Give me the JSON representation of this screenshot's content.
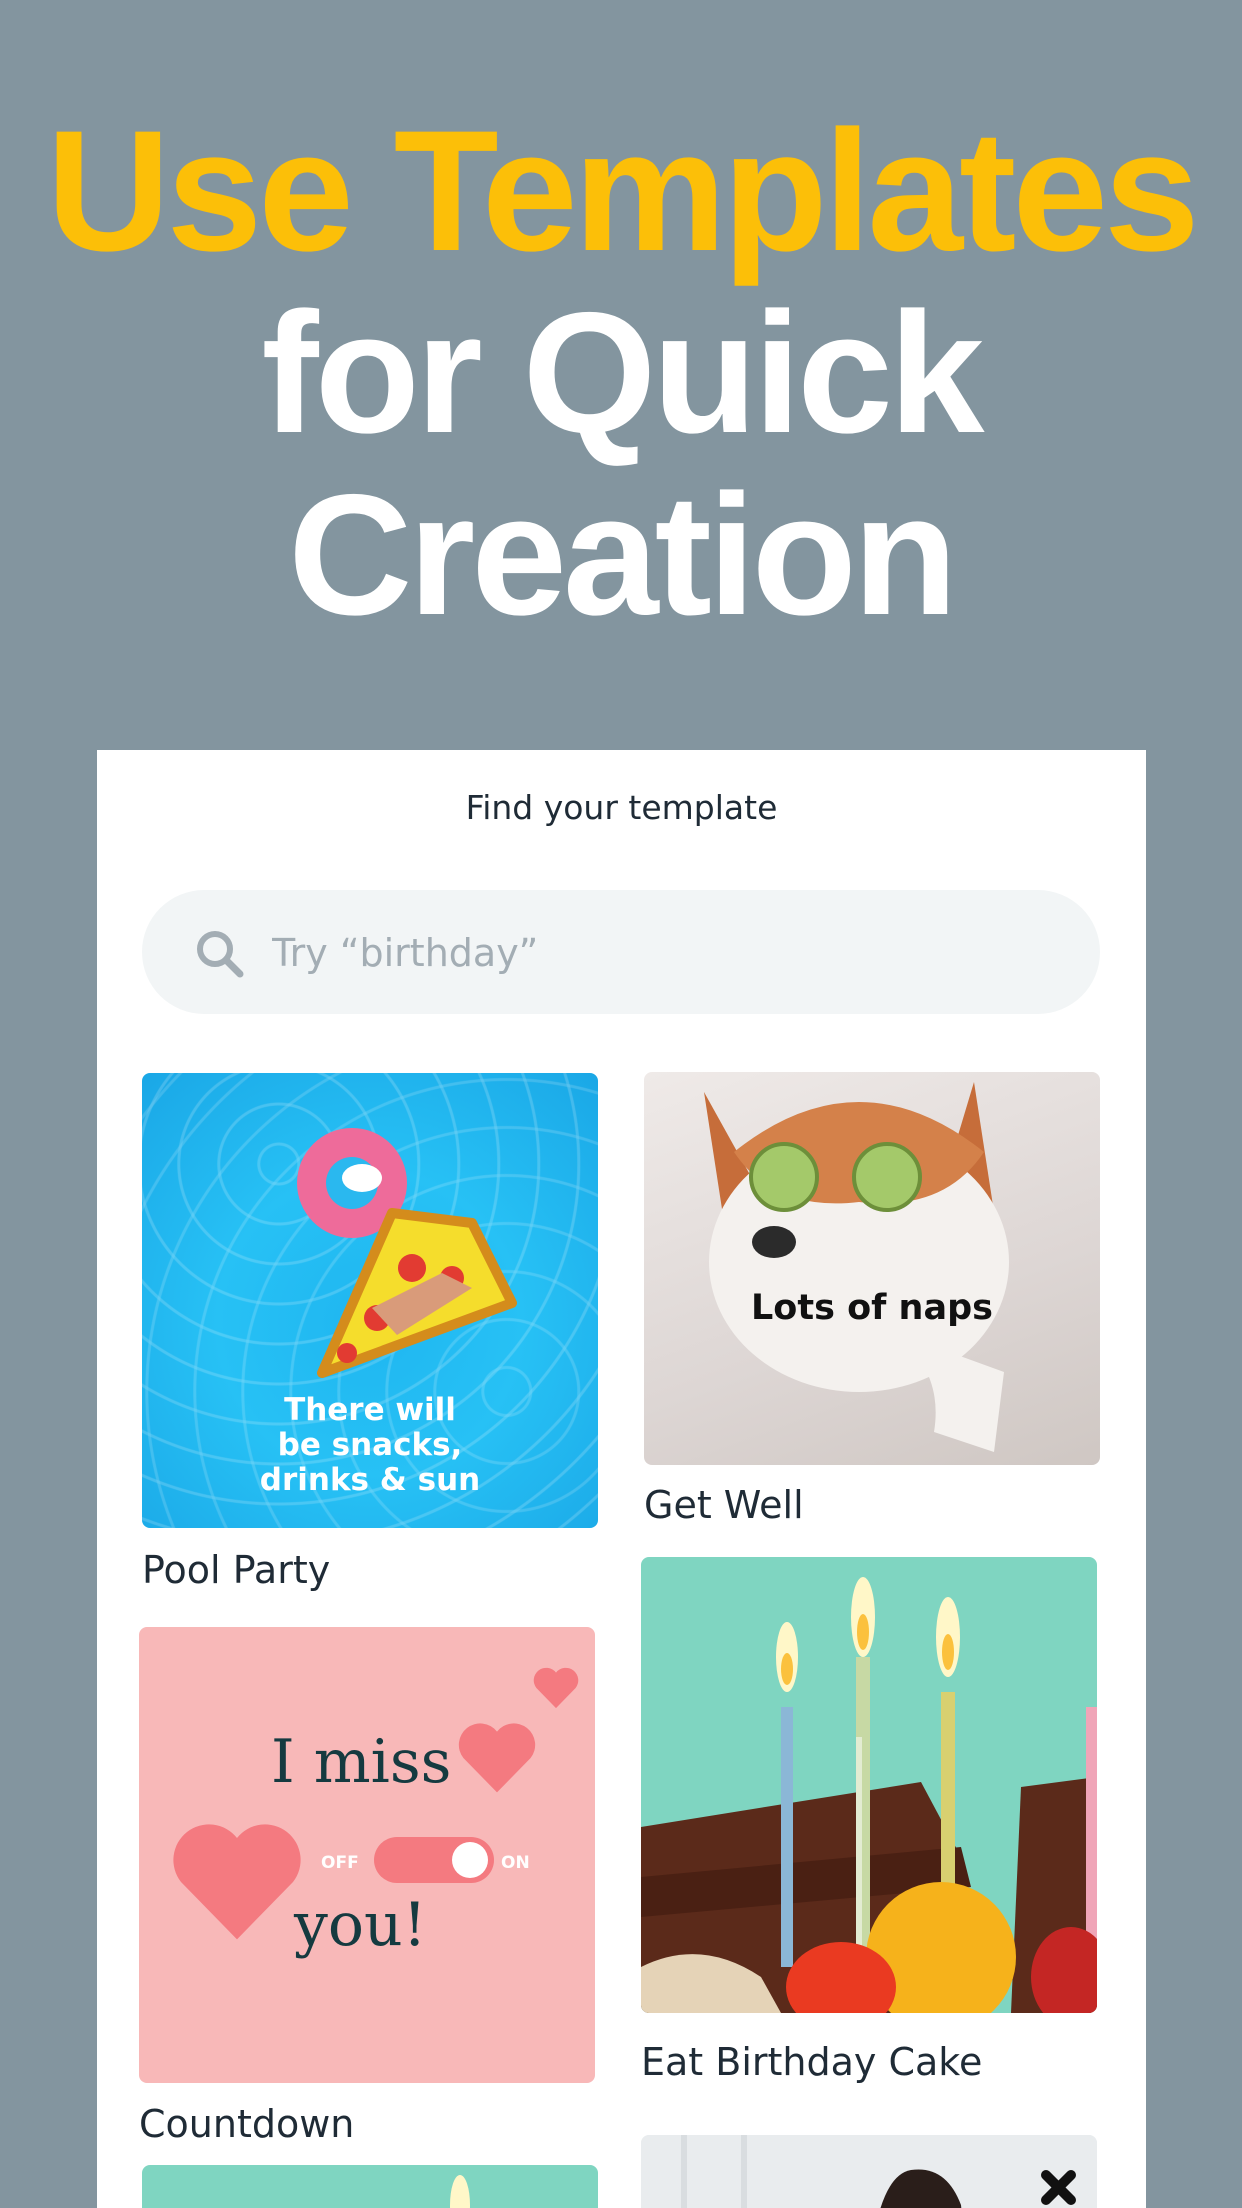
{
  "hero": {
    "line1": "Use Templates",
    "line2": "for Quick",
    "line3": "Creation"
  },
  "colors": {
    "background": "#83959f",
    "accent": "#fcbf08",
    "panel": "#ffffff"
  },
  "panel": {
    "title": "Find your template"
  },
  "search": {
    "placeholder": "Try “birthday”",
    "icon": "search-icon"
  },
  "templates": [
    {
      "label": "Pool Party",
      "overlay_text": "There will\nbe snacks,\ndrinks & sun"
    },
    {
      "label": "Get Well",
      "overlay_text": "Lots of naps"
    },
    {
      "label": "Countdown",
      "overlay_text_1": "I miss",
      "overlay_text_2": "you!",
      "toggle_off": "OFF",
      "toggle_on": "ON"
    },
    {
      "label": "Eat Birthday Cake"
    }
  ]
}
